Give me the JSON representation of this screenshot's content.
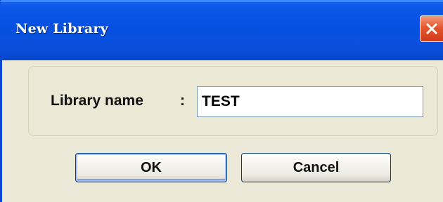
{
  "dialog": {
    "title": "New Library",
    "close_icon": "close-icon",
    "library_name_label": "Library name",
    "separator": ":",
    "library_name_value": "TEST",
    "ok_label": "OK",
    "cancel_label": "Cancel"
  },
  "colors": {
    "titlebar": "#0550e0",
    "close_button": "#e4562f",
    "client_background": "#ece9d8"
  }
}
